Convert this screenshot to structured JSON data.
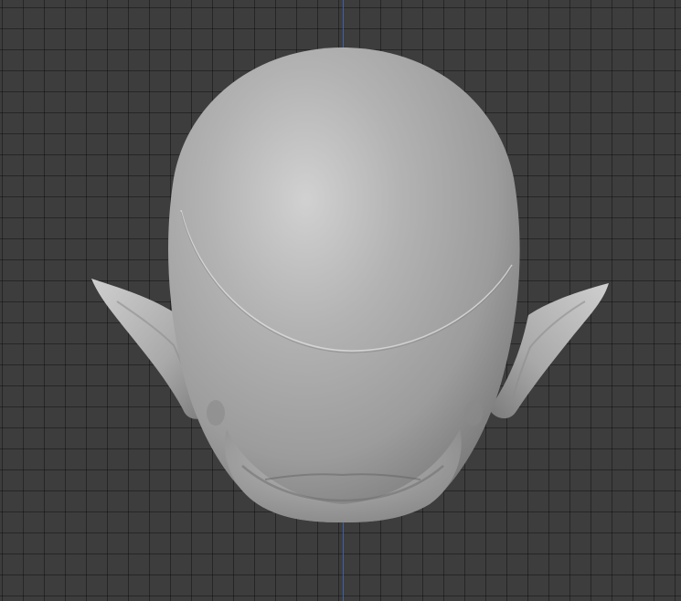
{
  "viewport": {
    "background_color": "#3d3d3d",
    "grid_line_color": "#2b2b2b",
    "y_axis_color": "#3f66b8"
  },
  "model": {
    "name": "sculpted-head-with-pointed-ears",
    "view": "top",
    "base_color": "#a8a8a8",
    "highlight_color": "#cfcfcf",
    "shadow_color": "#6e6e6e"
  }
}
